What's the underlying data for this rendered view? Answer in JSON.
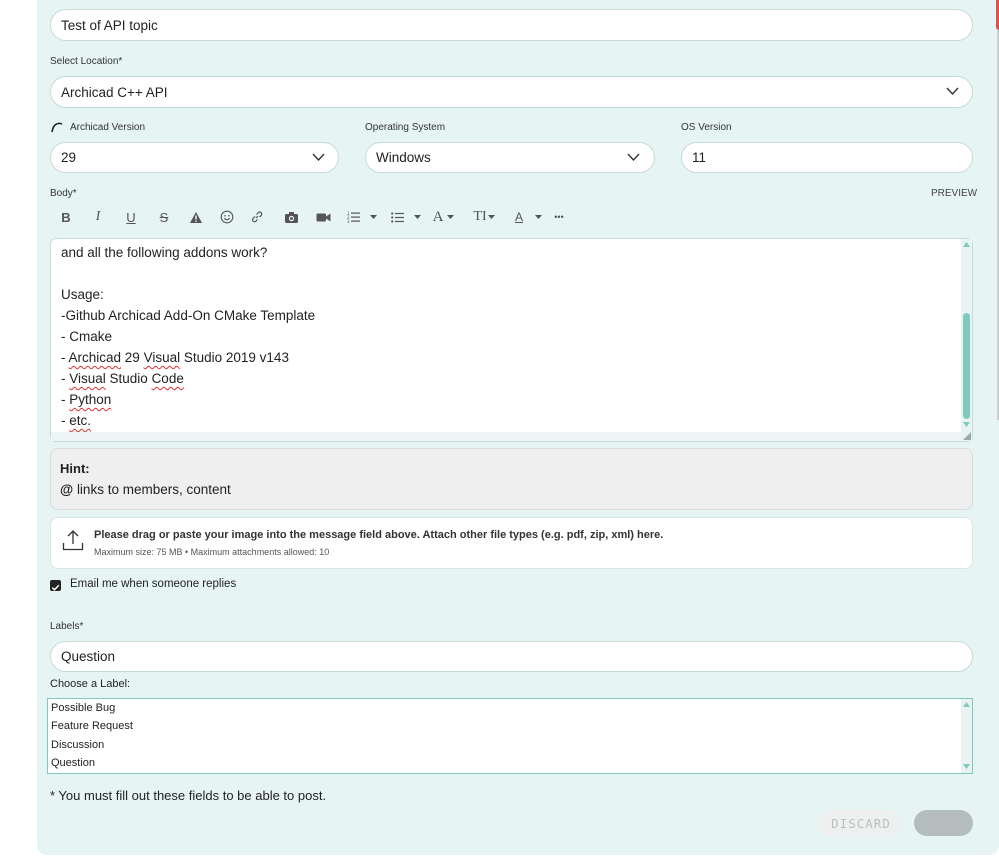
{
  "subject": {
    "value": "Test of API topic"
  },
  "location": {
    "label": "Select Location*",
    "value": "Archicad C++ API"
  },
  "version": {
    "label": "Archicad Version",
    "value": "29"
  },
  "os": {
    "label": "Operating System",
    "value": "Windows"
  },
  "os_version": {
    "label": "OS Version",
    "value": "11"
  },
  "body": {
    "label": "Body*",
    "preview_label": "PREVIEW",
    "lines": [
      "and all the following addons work?",
      "",
      "Usage:",
      "-Github Archicad Add-On CMake Template",
      "- Cmake",
      "- Archicad 29 Visual Studio 2019 v143",
      "- Visual Studio Code",
      "- Python",
      "- etc."
    ],
    "line5_parts": [
      "- ",
      "Archicad",
      " 29 ",
      "Visual",
      " Studio 2019 v143"
    ],
    "line6_parts": [
      "- ",
      "Visual",
      " Studio ",
      "Code"
    ],
    "line7_parts": [
      "- ",
      "Python"
    ],
    "line8_parts": [
      "- ",
      "etc."
    ]
  },
  "toolbar": {
    "bold": "B",
    "italic": "I",
    "underline": "U",
    "strike": "S",
    "font_size": "TI",
    "font_family": "A",
    "font_color": "A",
    "more": "•••"
  },
  "hint": {
    "title": "Hint:",
    "at": "@",
    "text": "links to members, content"
  },
  "attachments": {
    "main": "Please drag or paste your image into the message field above. Attach other file types (e.g. pdf, zip, xml) here.",
    "sub": "Maximum size: 75 MB • Maximum attachments allowed: 10"
  },
  "email_option": {
    "label": "Email me when someone replies",
    "checked": true
  },
  "labels": {
    "label": "Labels*",
    "value": "Question",
    "choose_label": "Choose a Label:",
    "options": [
      "Possible Bug",
      "Feature Request",
      "Discussion",
      "Question"
    ]
  },
  "required_note": "* You must fill out these fields to be able to post.",
  "actions": {
    "discard": "DISCARD"
  },
  "colors": {
    "panel": "#e6f5f3",
    "accent": "#7fc9c0",
    "post_button": "#b5bcbd"
  }
}
